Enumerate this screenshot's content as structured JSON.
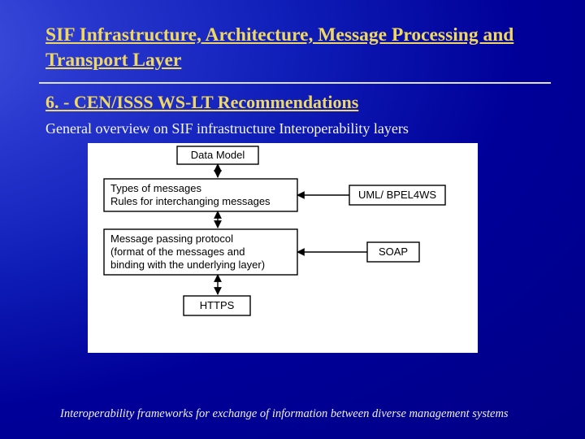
{
  "title": "SIF Infrastructure, Architecture, Message Processing and Transport Layer",
  "section_heading": "6. - CEN/ISSS WS-LT Recommendations",
  "body_text": "General overview on SIF infrastructure Interoperability layers",
  "footer": "Interoperability frameworks for exchange of information between diverse management systems",
  "diagram": {
    "main_boxes": [
      {
        "lines": [
          "Data Model"
        ]
      },
      {
        "lines": [
          "Types of messages",
          "Rules for interchanging messages"
        ]
      },
      {
        "lines": [
          "Message passing protocol",
          "(format of the messages and",
          "binding with the underlying layer)"
        ]
      },
      {
        "lines": [
          "HTTPS"
        ]
      }
    ],
    "side_boxes": [
      {
        "text": "UML/ BPEL4WS"
      },
      {
        "text": "SOAP"
      }
    ]
  }
}
